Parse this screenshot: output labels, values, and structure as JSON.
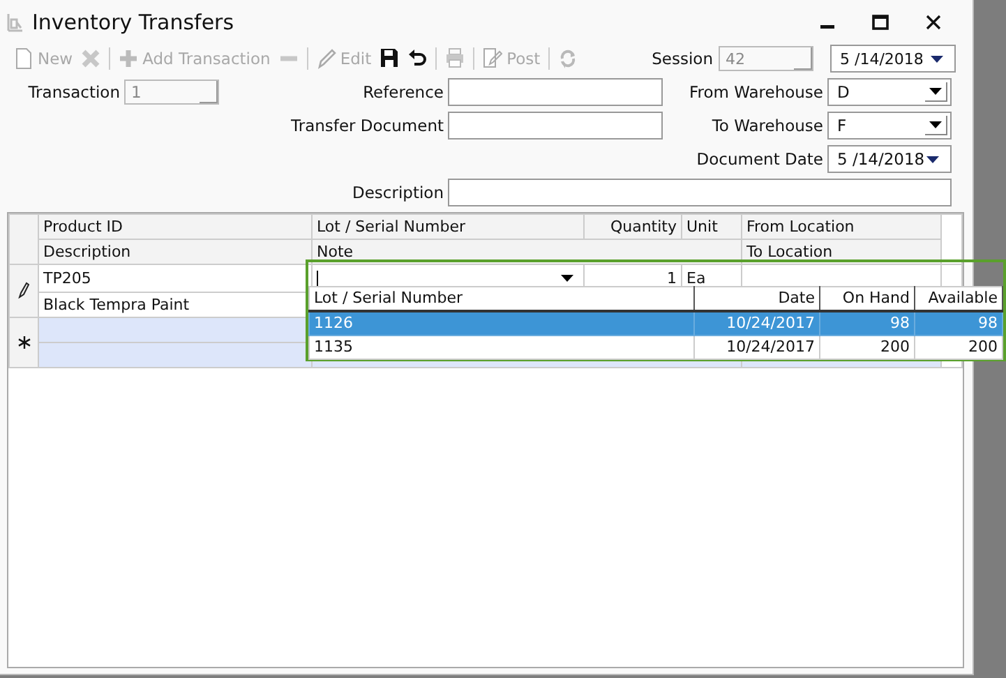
{
  "window": {
    "title": "Inventory Transfers"
  },
  "toolbar": [
    {
      "kind": "button",
      "label": "New",
      "disabled": true
    },
    {
      "kind": "icon",
      "disabled": true
    },
    {
      "kind": "separator"
    },
    {
      "kind": "button",
      "label": "Add Transaction",
      "disabled": true
    },
    {
      "kind": "icon",
      "disabled": true
    },
    {
      "kind": "separator"
    },
    {
      "kind": "button",
      "label": "Edit",
      "disabled": true
    },
    {
      "kind": "icon",
      "disabled": false
    },
    {
      "kind": "icon",
      "disabled": false
    },
    {
      "kind": "separator"
    },
    {
      "kind": "icon",
      "disabled": true
    },
    {
      "kind": "separator"
    },
    {
      "kind": "button",
      "label": "Post",
      "disabled": true
    },
    {
      "kind": "separator"
    },
    {
      "kind": "icon",
      "disabled": true
    }
  ],
  "session": {
    "label": "Session",
    "value": "42",
    "disabled": true,
    "date": "5 /14/2018"
  },
  "form": {
    "transaction": {
      "label": "Transaction",
      "value": "1",
      "disabled": true
    },
    "reference": {
      "label": "Reference"
    },
    "transfer_document": {
      "label": "Transfer Document"
    },
    "from_warehouse": {
      "label": "From Warehouse",
      "value": "D"
    },
    "to_warehouse": {
      "label": "To Warehouse",
      "value": "F"
    },
    "document_date": {
      "label": "Document Date",
      "value": "5 /14/2018"
    },
    "description": {
      "label": "Description"
    }
  },
  "grid": {
    "columns_line1": [
      "Product ID",
      "Lot / Serial Number",
      "Quantity",
      "Unit",
      "From Location"
    ],
    "columns_line2": [
      "Description",
      "Note",
      "To Location"
    ],
    "row": {
      "product_id": "TP205",
      "quantity": "1",
      "unit": "Ea",
      "description": "Black Tempra Paint"
    }
  },
  "lot_dropdown": {
    "columns": [
      "Lot / Serial Number",
      "Date",
      "On Hand",
      "Available"
    ],
    "rows": [
      {
        "cells": [
          "1126",
          "10/24/2017",
          "98",
          "98"
        ],
        "selected": true
      },
      {
        "cells": [
          "1135",
          "10/24/2017",
          "200",
          "200"
        ],
        "selected": false
      }
    ]
  }
}
